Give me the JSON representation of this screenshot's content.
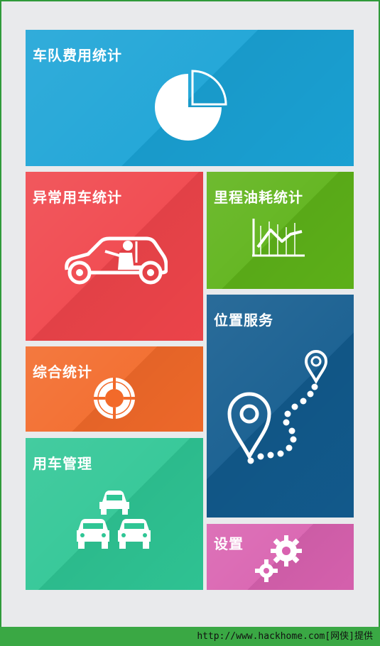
{
  "colors": {
    "fleet_cost": "#1aa3d6",
    "abnormal": "#f0454b",
    "mileage": "#5eb319",
    "comprehensive": "#f26a2a",
    "location": "#125b8e",
    "vehicle_mgmt": "#2fc695",
    "settings": "#d962b0",
    "footer": "#3aa844"
  },
  "tiles": {
    "fleet_cost": {
      "label": "车队费用统计",
      "icon": "pie-chart-icon"
    },
    "abnormal_usage": {
      "label": "异常用车统计",
      "icon": "car-driver-icon"
    },
    "mileage_fuel": {
      "label": "里程油耗统计",
      "icon": "line-chart-icon"
    },
    "location": {
      "label": "位置服务",
      "icon": "map-route-icon"
    },
    "comprehensive": {
      "label": "综合统计",
      "icon": "lifebuoy-icon"
    },
    "vehicle_mgmt": {
      "label": "用车管理",
      "icon": "cars-icon"
    },
    "settings": {
      "label": "设置",
      "icon": "gears-icon"
    }
  },
  "footer": {
    "text": "http://www.hackhome.com[网侠]提供"
  }
}
